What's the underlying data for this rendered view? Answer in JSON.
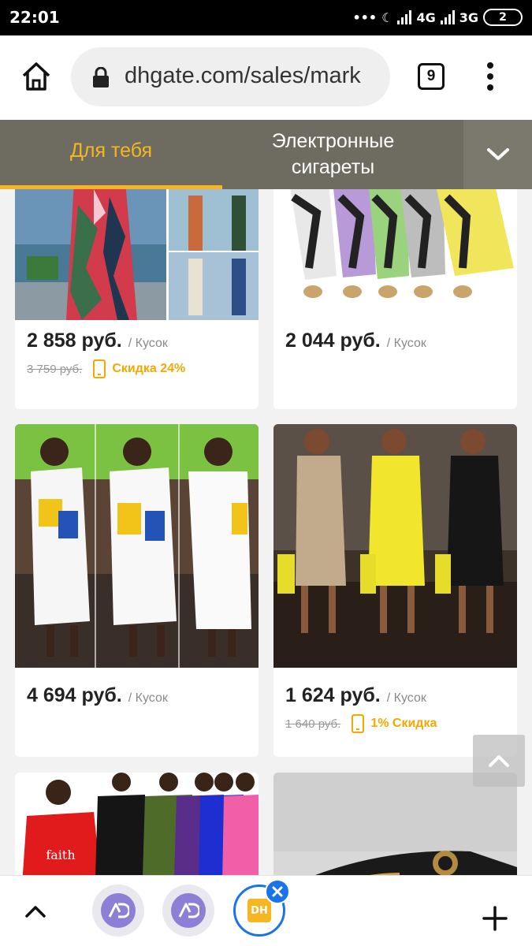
{
  "status_bar": {
    "time": "22:01",
    "dots": "•••",
    "moon": "☾",
    "network_1": "4G",
    "network_2": "3G",
    "battery": "2"
  },
  "browser": {
    "url": "dhgate.com/sales/mark",
    "tab_count": "9"
  },
  "categories": {
    "tab_1": "Для тебя",
    "tab_2": "Электронные сигареты",
    "accent_color": "#f6b622"
  },
  "products": [
    {
      "price": "2 858 руб.",
      "unit": "/ Кусок",
      "old_price": "3 759 руб.",
      "discount": "Скидка 24%"
    },
    {
      "price": "2 044 руб.",
      "unit": "/ Кусок"
    },
    {
      "price": "4 694 руб.",
      "unit": "/ Кусок"
    },
    {
      "price": "1 624 руб.",
      "unit": "/ Кусок",
      "old_price": "1 640 руб.",
      "discount": "1% Скидка"
    },
    {
      "text": "faith"
    },
    {}
  ],
  "bottom_bar": {
    "app_badge_1": "AD",
    "app_badge_2": "AD",
    "app_badge_3": "DH"
  }
}
